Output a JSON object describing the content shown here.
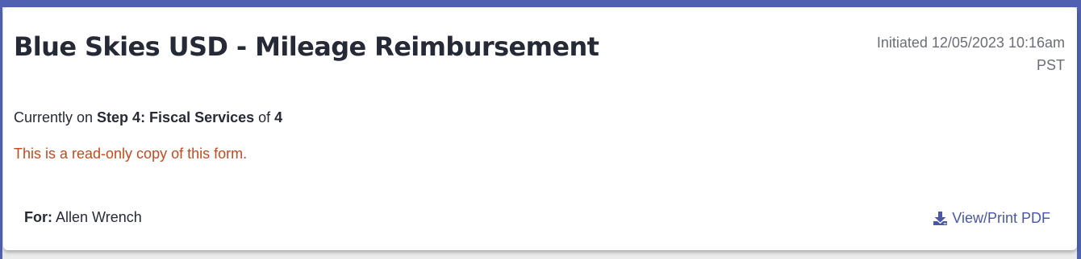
{
  "form": {
    "title": "Blue Skies USD - Mileage Reimbursement",
    "initiated_label": "Initiated 12/05/2023 10:16am",
    "initiated_tz": "PST"
  },
  "progress": {
    "prefix": "Currently on ",
    "step_name": "Step 4: Fiscal Services",
    "of_text": " of ",
    "total": "4"
  },
  "notice": {
    "readonly": "This is a read-only copy of this form."
  },
  "recipient": {
    "label": "For:",
    "name": " Allen Wrench"
  },
  "actions": {
    "pdf_label": "View/Print PDF",
    "pdf_icon": "download-icon"
  },
  "colors": {
    "accent": "#5061b1",
    "link": "#4a57a8",
    "warning_text": "#c34a1e",
    "title_text": "#262a36"
  }
}
